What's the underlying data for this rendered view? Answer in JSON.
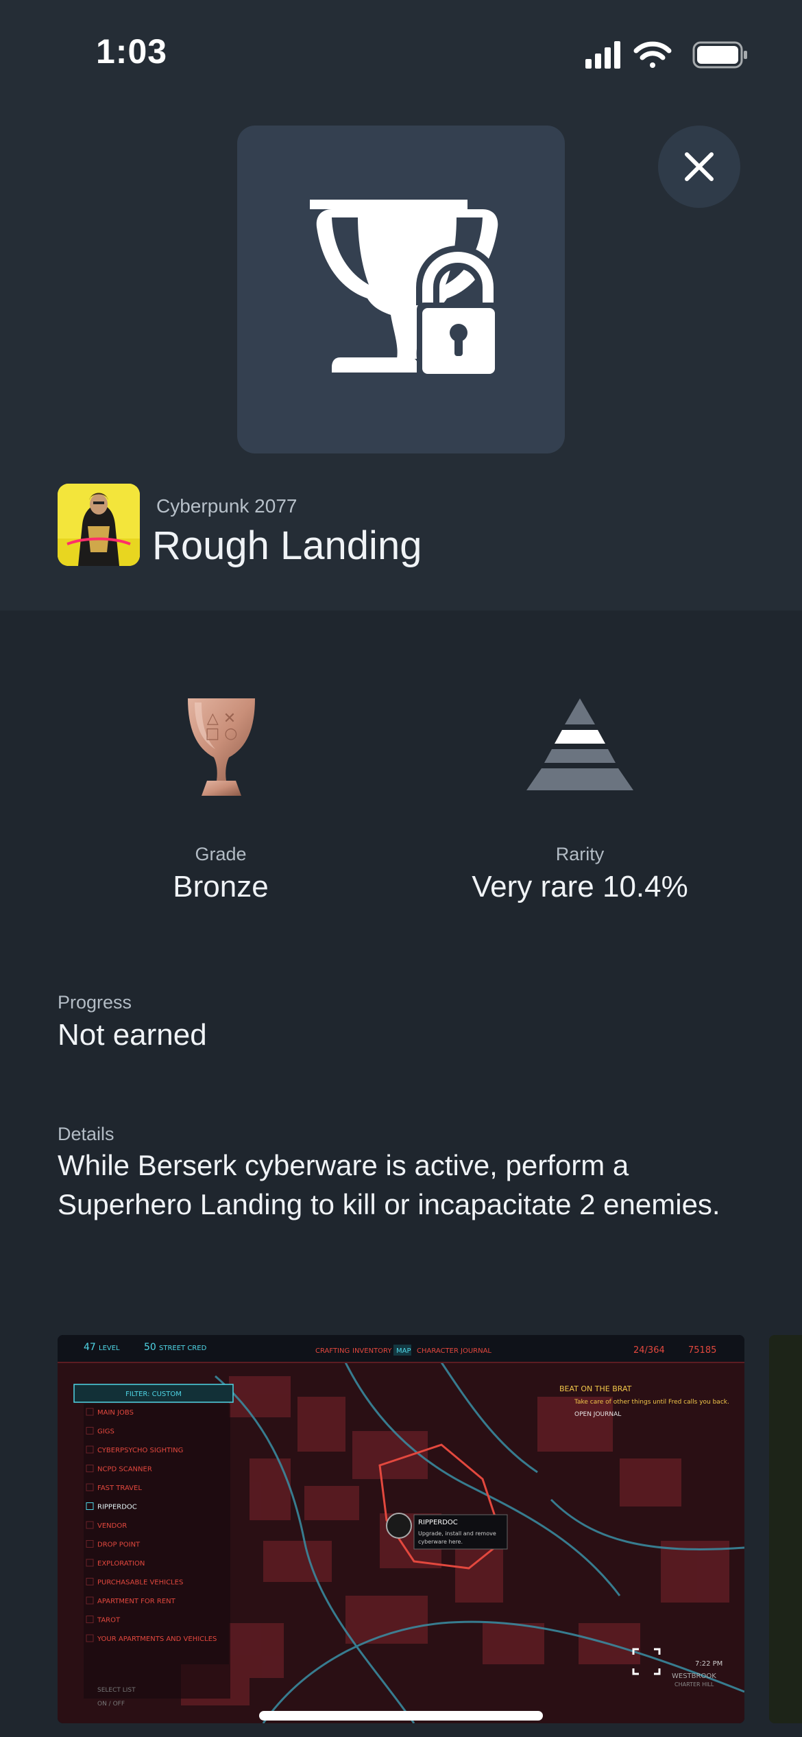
{
  "status_bar": {
    "time": "1:03"
  },
  "trophy": {
    "game_title": "Cyberpunk 2077",
    "name": "Rough Landing",
    "locked": true
  },
  "stats": {
    "grade_label": "Grade",
    "grade_value": "Bronze",
    "rarity_label": "Rarity",
    "rarity_value": "Very rare 10.4%"
  },
  "progress": {
    "label": "Progress",
    "value": "Not earned"
  },
  "details": {
    "label": "Details",
    "text": "While Berserk cyberware is active, perform a Superhero Landing to kill or incapacitate 2 enemies."
  },
  "screenshot": {
    "level": "47",
    "level_label": "LEVEL",
    "street_cred": "50",
    "street_cred_label": "STREET CRED",
    "tabs": [
      "CRAFTING",
      "INVENTORY",
      "MAP",
      "CHARACTER",
      "JOURNAL"
    ],
    "health": "24/364",
    "money": "75185",
    "filter": "FILTER: CUSTOM",
    "filter_items": [
      "MAIN JOBS",
      "GIGS",
      "CYBERPSYCHO SIGHTING",
      "NCPD SCANNER",
      "FAST TRAVEL",
      "RIPPERDOC",
      "VENDOR",
      "DROP POINT",
      "EXPLORATION",
      "PURCHASABLE VEHICLES",
      "APARTMENT FOR RENT",
      "TAROT",
      "YOUR APARTMENTS AND VEHICLES"
    ],
    "quest_title": "BEAT ON THE BRAT",
    "quest_text": "Take care of other things until Fred calls you back.",
    "open_journal": "OPEN JOURNAL",
    "tooltip_title": "RIPPERDOC",
    "tooltip_line1": "Upgrade, install and remove",
    "tooltip_line2": "cyberware here.",
    "select_list": "SELECT LIST",
    "on_off": "ON / OFF",
    "game_time": "7:22 PM",
    "district": "WESTBROOK",
    "subdistrict": "CHARTER HILL"
  },
  "colors": {
    "background": "#1f262e",
    "top_panel": "#252d36",
    "bronze": "#c98f79",
    "hud_red": "#e3483e",
    "hud_cyan": "#4fd6e6"
  }
}
